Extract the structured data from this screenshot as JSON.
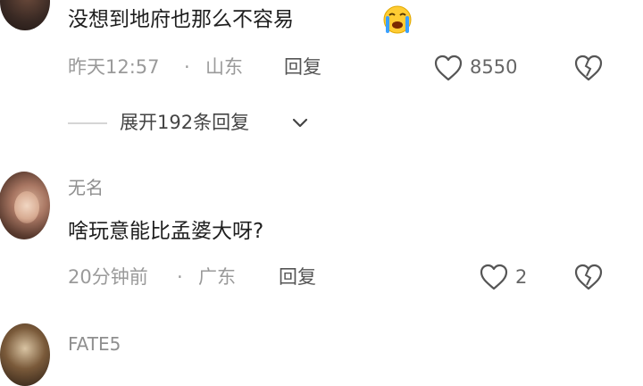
{
  "comments": [
    {
      "text": "没想到地府也那么不容易",
      "emoji": "loudly-crying-face-emoji",
      "time": "昨天12:57",
      "separator": "·",
      "location": "山东",
      "reply_label": "回复",
      "likes": "8550",
      "replies_expand": "展开192条回复"
    },
    {
      "username": "无名",
      "text": "啥玩意能比孟婆大呀?",
      "time": "20分钟前",
      "separator": "·",
      "location": "广东",
      "reply_label": "回复",
      "likes": "2"
    },
    {
      "username": "FATE5"
    }
  ],
  "colors": {
    "primary_text": "#1f1f1f",
    "meta_text": "#9a9a9a",
    "background": "#ffffff"
  },
  "icons": [
    "heart-outline-icon",
    "broken-heart-icon",
    "chevron-down-icon"
  ]
}
